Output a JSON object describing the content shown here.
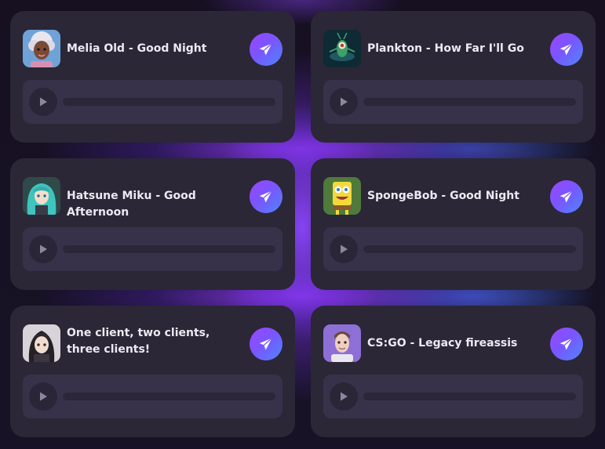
{
  "cards": [
    {
      "title": "Melia Old - Good Night",
      "avatar_icon": "old-woman-avatar-icon"
    },
    {
      "title": "Plankton - How Far I'll Go",
      "avatar_icon": "plankton-avatar-icon"
    },
    {
      "title": "Hatsune Miku - Good Afternoon",
      "avatar_icon": "miku-avatar-icon"
    },
    {
      "title": "SpongeBob - Good Night",
      "avatar_icon": "spongebob-avatar-icon"
    },
    {
      "title": "One client, two clients, three clients!",
      "avatar_icon": "anime-girl-avatar-icon"
    },
    {
      "title": "CS:GO - Legacy fireassis",
      "avatar_icon": "man-avatar-icon"
    }
  ],
  "colors": {
    "card_bg": "#2b2736",
    "player_bg": "#37324a",
    "accent_from": "#9b46ff",
    "accent_to": "#4d86ff"
  },
  "icons": {
    "send": "paper-plane-icon",
    "play": "play-icon"
  }
}
